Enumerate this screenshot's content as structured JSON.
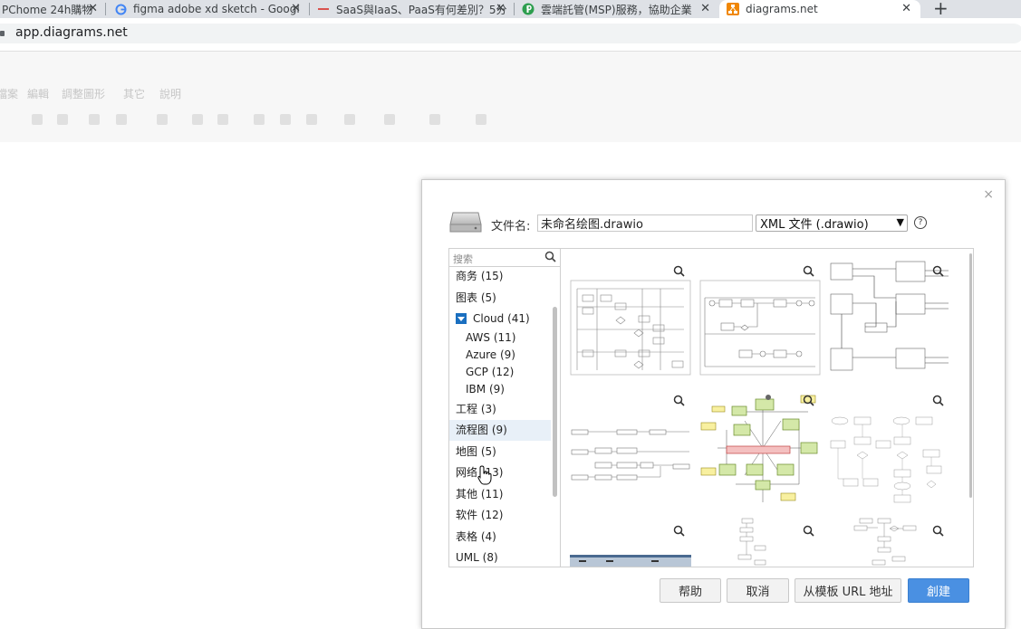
{
  "browser": {
    "tabs": [
      {
        "title": "PChome 24h購物",
        "close": "✕"
      },
      {
        "title": "figma adobe xd sketch - Googl",
        "close": "✕"
      },
      {
        "title": "SaaS與IaaS、PaaS有何差別？5分",
        "close": "✕"
      },
      {
        "title": "雲端託管(MSP)服務，協助企業",
        "close": "✕"
      },
      {
        "title": "diagrams.net",
        "close": "✕"
      }
    ],
    "new_tab": "+",
    "url": "app.diagrams.net"
  },
  "app_menu": {
    "items": [
      "檔案",
      "編輯",
      "調整圖形",
      "其它",
      "說明"
    ]
  },
  "dialog": {
    "close": "×",
    "filename_label": "文件名:",
    "filename_value": "未命名绘图.drawio",
    "format_value": "XML 文件 (.drawio)",
    "help": "?",
    "search_placeholder": "搜索",
    "categories": [
      {
        "label": "商务 (15)"
      },
      {
        "label": "图表 (5)"
      },
      {
        "label": "Cloud (41)"
      },
      {
        "label": "AWS (11)"
      },
      {
        "label": "Azure (9)"
      },
      {
        "label": "GCP (12)"
      },
      {
        "label": "IBM (9)"
      },
      {
        "label": "工程 (3)"
      },
      {
        "label": "流程图 (9)"
      },
      {
        "label": "地图 (5)"
      },
      {
        "label": "网络 (13)"
      },
      {
        "label": "其他 (11)"
      },
      {
        "label": "软件 (12)"
      },
      {
        "label": "表格 (4)"
      },
      {
        "label": "UML (8)"
      }
    ],
    "buttons": {
      "help": "帮助",
      "cancel": "取消",
      "from_url": "从模板 URL 地址",
      "create": "創建"
    }
  },
  "colors": {
    "accent": "#4a90e2",
    "selected_category": "#e8f0f8",
    "cloud_chevron": "#1a6fc0"
  }
}
